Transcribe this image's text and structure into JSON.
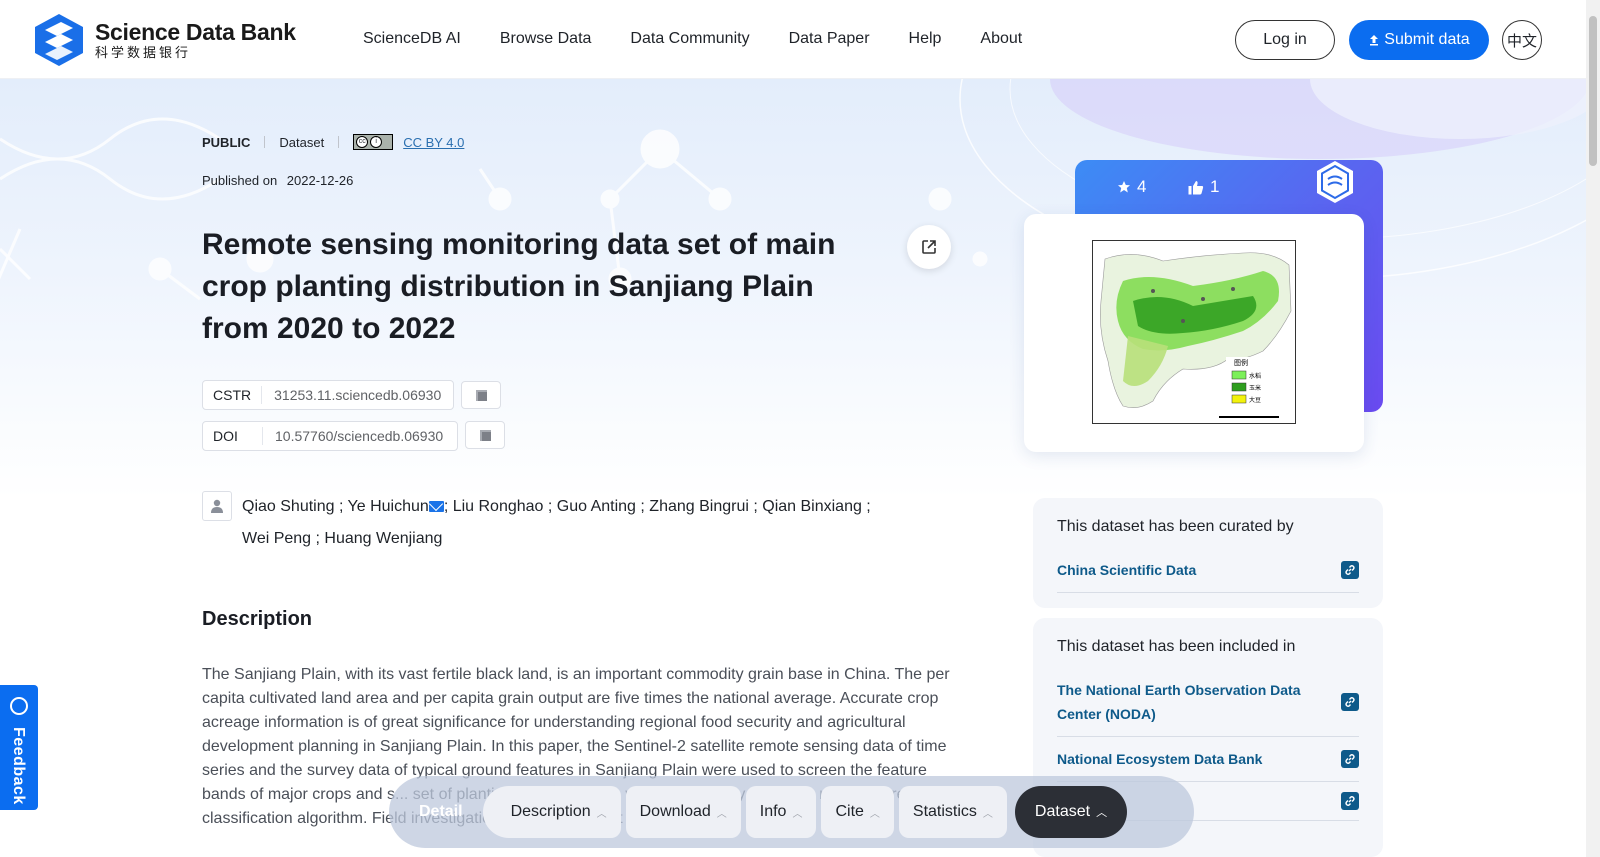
{
  "header": {
    "logo_en": "Science Data Bank",
    "logo_cn": "科学数据银行",
    "nav": [
      "ScienceDB AI",
      "Browse Data",
      "Data Community",
      "Data Paper",
      "Help",
      "About"
    ],
    "login_label": "Log in",
    "submit_label": "Submit data",
    "lang_label": "中文"
  },
  "dataset": {
    "access": "PUBLIC",
    "type": "Dataset",
    "license": "CC BY 4.0",
    "published_label": "Published on",
    "published_date": "2022-12-26",
    "title": "Remote sensing monitoring data set of main crop planting distribution in Sanjiang Plain from 2020 to 2022",
    "cstr_label": "CSTR",
    "cstr_value": "31253.11.sciencedb.06930",
    "doi_label": "DOI",
    "doi_value": "10.57760/sciencedb.06930",
    "authors_line1_a": "Qiao Shuting ; Ye Huichun",
    "authors_line1_b": "; Liu Ronghao ; Guo Anting ; Zhang Bingrui ; Qian Binxiang ;",
    "authors_line2": "Wei Peng ; Huang Wenjiang",
    "description_heading": "Description",
    "description": "The Sanjiang Plain, with its vast fertile black land, is an important commodity grain base in China. The per capita cultivated land area and per capita grain output are five times the national average. Accurate crop acreage information is of great significance for understanding regional food security and agricultural development planning in Sanjiang Plain. In this paper, the Sentinel-2 satellite remote sensing data of time series and the survey data of typical ground features in Sanjiang Plain were used to screen the feature bands of major crops and s... set of planting distribution o... was extracted by using the random forest classification algorithm. Field investigation data verified that the"
  },
  "stats": {
    "stars": "4",
    "likes": "1"
  },
  "map_legend": {
    "title": "图例",
    "items": [
      "水稻",
      "玉米",
      "大豆"
    ],
    "colors": [
      "#7cf05a",
      "#2e9e1e",
      "#f2f20c"
    ]
  },
  "curated": {
    "heading": "This dataset has been curated by",
    "items": [
      "China Scientific Data"
    ]
  },
  "included": {
    "heading": "This dataset has been included in",
    "items": [
      "The National Earth Observation Data Center (NODA)",
      "National Ecosystem Data Bank",
      ""
    ]
  },
  "feedback_label": "Feedback",
  "bottom_nav": {
    "detail": "Detail",
    "items": [
      "Description",
      "Download",
      "Info",
      "Cite",
      "Statistics"
    ],
    "active": "Dataset"
  }
}
